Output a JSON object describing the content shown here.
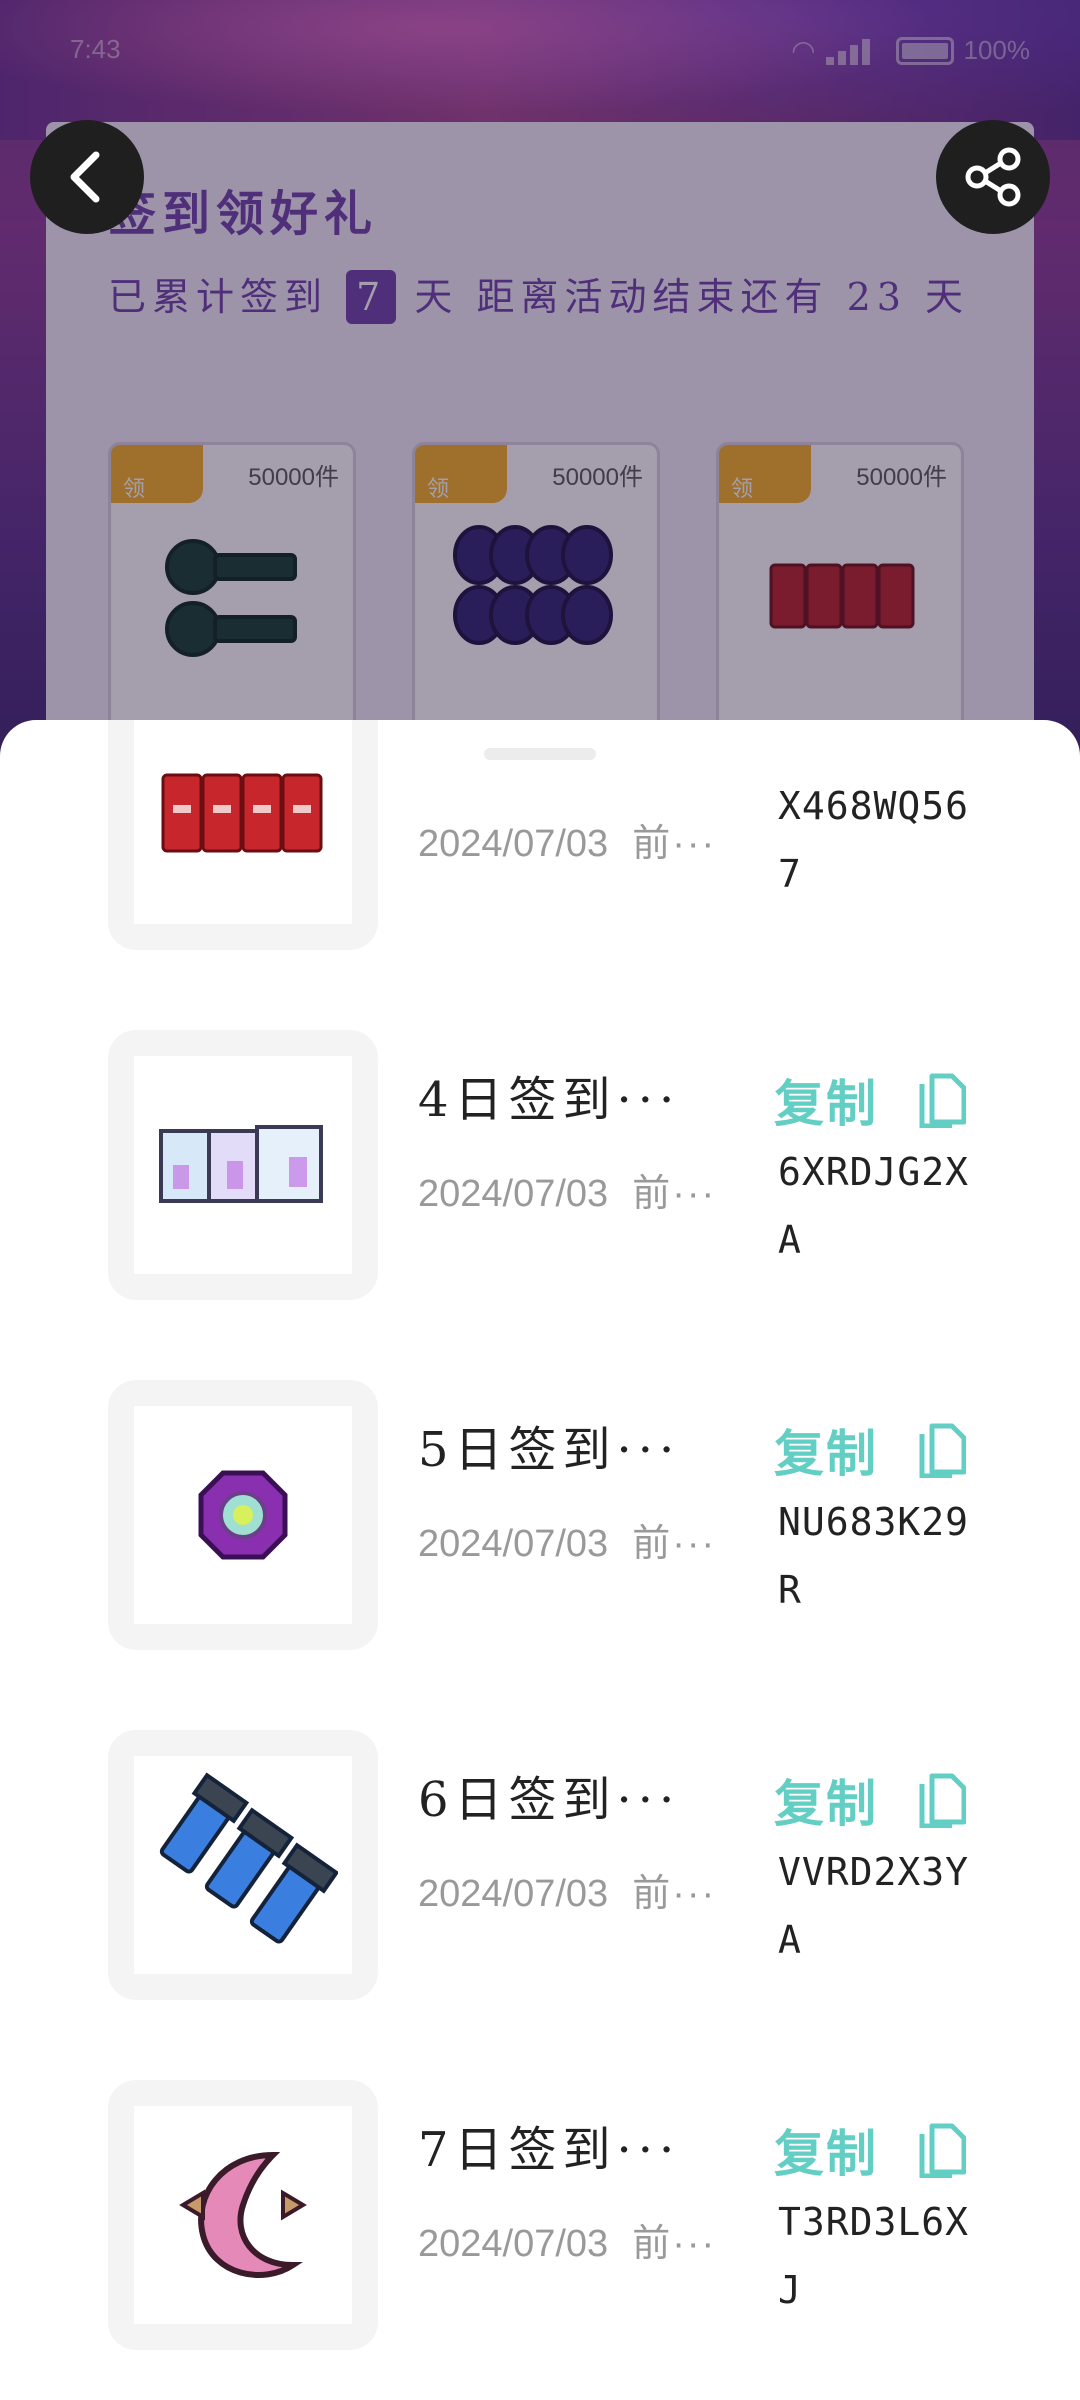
{
  "status_bar": {
    "time": "7:43",
    "battery": "100%"
  },
  "background": {
    "title": "签到领好礼",
    "progress_prefix": "已累计签到",
    "signed_days": "7",
    "progress_mid": "天  距离活动结束还有",
    "remaining_days": "23",
    "progress_suffix": "天",
    "prizes": [
      {
        "tag": "领",
        "count": "50000件",
        "icon": "key-icon"
      },
      {
        "tag": "领",
        "count": "50000件",
        "icon": "coin-stack-icon"
      },
      {
        "tag": "领",
        "count": "50000件",
        "icon": "cans-icon"
      }
    ]
  },
  "sheet": {
    "items": [
      {
        "title": "",
        "date": "2024/07/03",
        "date_more": "前···",
        "copy_label": "",
        "code": "X468WQ567",
        "icon": "cans-icon"
      },
      {
        "title": "4日签到···",
        "date": "2024/07/03",
        "date_more": "前···",
        "copy_label": "复制",
        "code": "6XRDJG2XA",
        "icon": "crystal-blocks-icon"
      },
      {
        "title": "5日签到···",
        "date": "2024/07/03",
        "date_more": "前···",
        "copy_label": "复制",
        "code": "NU683K29R",
        "icon": "gem-icon"
      },
      {
        "title": "6日签到···",
        "date": "2024/07/03",
        "date_more": "前···",
        "copy_label": "复制",
        "code": "VVRD2X3YA",
        "icon": "flashlights-icon"
      },
      {
        "title": "7日签到···",
        "date": "2024/07/03",
        "date_more": "前···",
        "copy_label": "复制",
        "code": "T3RD3L6XJ",
        "icon": "crescent-icon"
      }
    ]
  },
  "colors": {
    "accent": "#63cfc4",
    "brand": "#6b3fa8",
    "tag": "#f5b021"
  }
}
